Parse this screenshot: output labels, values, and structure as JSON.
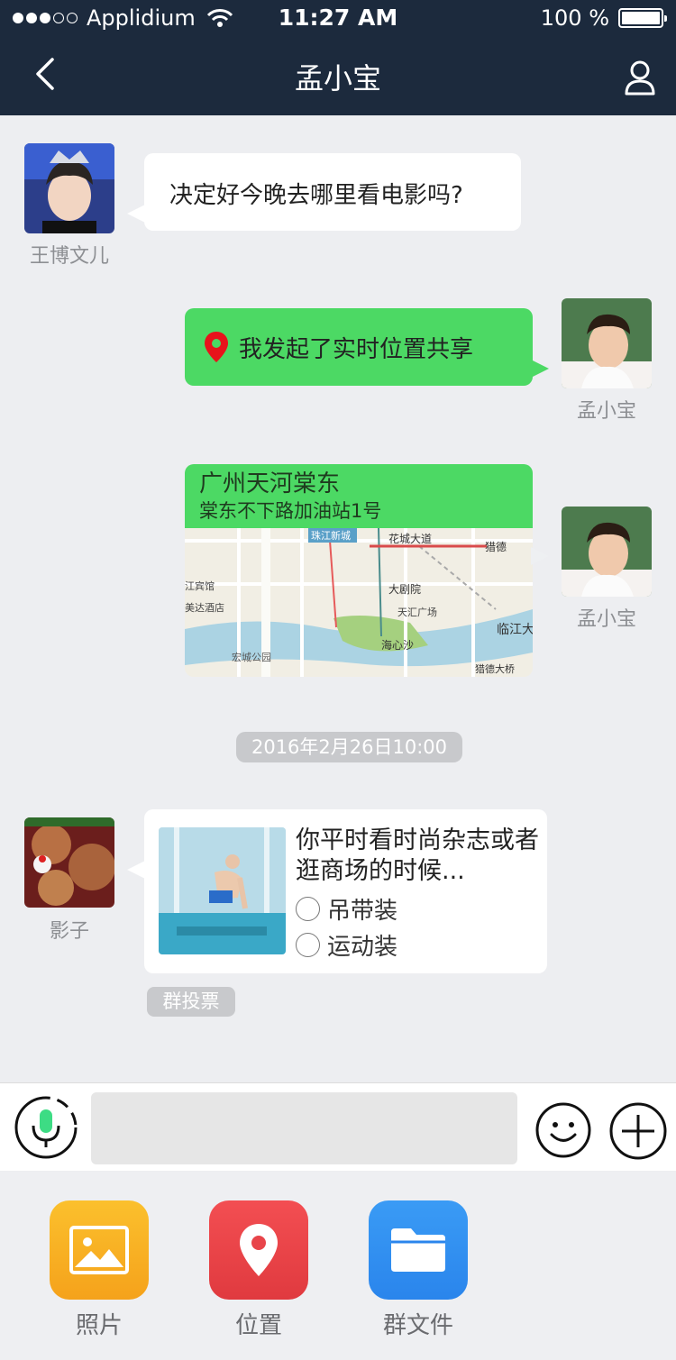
{
  "status_bar": {
    "carrier": "Applidium",
    "time": "11:27 AM",
    "battery": "100 %"
  },
  "nav": {
    "title": "孟小宝"
  },
  "messages": {
    "m1": {
      "sender": "王博文儿",
      "text": "决定好今晚去哪里看电影吗?"
    },
    "m2": {
      "sender": "孟小宝",
      "text": "我发起了实时位置共享"
    },
    "m3": {
      "sender": "孟小宝",
      "title": "广州天河棠东",
      "subtitle": "棠东不下路加油站1号",
      "map_labels": [
        "珠江新城",
        "花城大道",
        "猎德",
        "江宾馆",
        "美达酒店",
        "大剧院",
        "天汇广场",
        "临江大",
        "宏城公园",
        "海心沙",
        "猎德大桥"
      ]
    },
    "timestamp": "2016年2月26日10:00",
    "m4": {
      "sender": "影子",
      "question": "你平时看时尚杂志或者逛商场的时候...",
      "options": [
        "吊带装",
        "运动装"
      ],
      "badge": "群投票"
    }
  },
  "input": {
    "placeholder": ""
  },
  "panel": {
    "tools": [
      {
        "label": "照片",
        "icon": "photo-icon",
        "color": "#f7b221"
      },
      {
        "label": "位置",
        "icon": "location-pin-icon",
        "color": "#ee4449"
      },
      {
        "label": "群文件",
        "icon": "folder-icon",
        "color": "#2d8ff0"
      }
    ]
  },
  "colors": {
    "nav_bg": "#1c2a3d",
    "bubble_green": "#4cd964",
    "background": "#edeef1"
  }
}
